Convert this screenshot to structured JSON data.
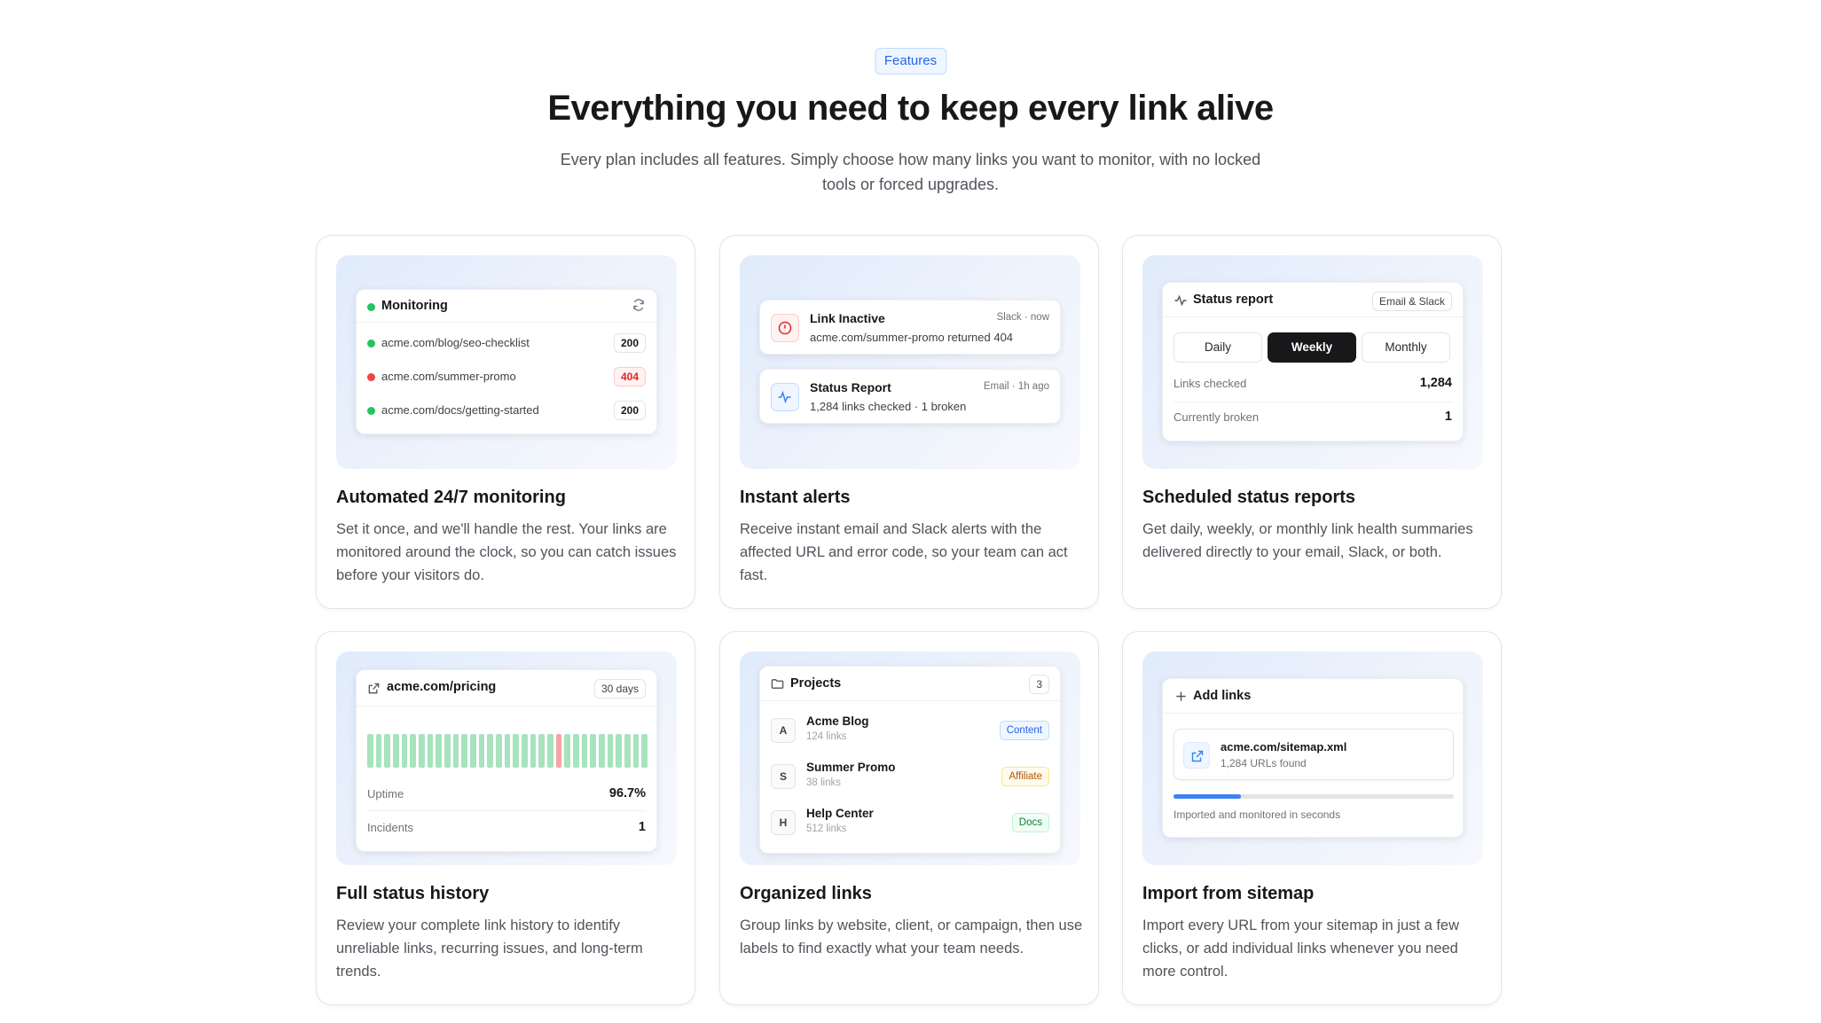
{
  "header": {
    "badge": "Features",
    "title": "Everything you need to keep every link alive",
    "subtitle": "Every plan includes all features. Simply choose how many links you want to monitor, with no locked tools or forced upgrades."
  },
  "colors": {
    "accent": "#2563eb",
    "ok": "#22c55e",
    "error": "#ef4444",
    "uptime_bar": "#a7e3bd",
    "incident_bar": "#f3a6a6"
  },
  "cards": {
    "monitoring": {
      "title": "Automated 24/7 monitoring",
      "desc": "Set it once, and we'll handle the rest. Your links are monitored around the clock, so you can catch issues before your visitors do.",
      "panel_title": "Monitoring",
      "refresh_icon": "refresh-icon",
      "rows": [
        {
          "url": "acme.com/blog/seo-checklist",
          "code": "200",
          "status": "ok"
        },
        {
          "url": "acme.com/summer-promo",
          "code": "404",
          "status": "error"
        },
        {
          "url": "acme.com/docs/getting-started",
          "code": "200",
          "status": "ok"
        }
      ]
    },
    "alerts": {
      "title": "Instant alerts",
      "desc": "Receive instant email and Slack alerts with the affected URL and error code, so your team can act fast.",
      "items": [
        {
          "icon": "alert-circle-icon",
          "title": "Link Inactive",
          "meta": "Slack · now",
          "body": "acme.com/summer-promo returned 404"
        },
        {
          "icon": "activity-icon",
          "title": "Status Report",
          "meta": "Email · 1h ago",
          "body": "1,284 links checked · 1 broken"
        }
      ]
    },
    "reports": {
      "title": "Scheduled status reports",
      "desc": "Get daily, weekly, or monthly link health summaries delivered directly to your email, Slack, or both.",
      "panel_title": "Status report",
      "channel": "Email & Slack",
      "tabs": [
        "Daily",
        "Weekly",
        "Monthly"
      ],
      "selected_tab": "Weekly",
      "stats": [
        {
          "label": "Links checked",
          "value": "1,284"
        },
        {
          "label": "Currently broken",
          "value": "1"
        }
      ]
    },
    "history": {
      "title": "Full status history",
      "desc": "Review your complete link history to identify unreliable links, recurring issues, and long-term trends.",
      "url": "acme.com/pricing",
      "range": "30 days",
      "bars": [
        "up",
        "up",
        "up",
        "up",
        "up",
        "up",
        "up",
        "up",
        "up",
        "up",
        "up",
        "up",
        "up",
        "up",
        "up",
        "up",
        "up",
        "up",
        "up",
        "up",
        "up",
        "up",
        "down",
        "up",
        "up",
        "up",
        "up",
        "up",
        "up",
        "up",
        "up",
        "up",
        "up"
      ],
      "stats": [
        {
          "label": "Uptime",
          "value": "96.7%"
        },
        {
          "label": "Incidents",
          "value": "1"
        }
      ]
    },
    "organized": {
      "title": "Organized links",
      "desc": "Group links by website, client, or campaign, then use labels to find exactly what your team needs.",
      "panel_title": "Projects",
      "count": "3",
      "projects": [
        {
          "initial": "A",
          "name": "Acme Blog",
          "links": "124 links",
          "label": "Content",
          "label_color": "#2563eb",
          "label_bg": "#eff6ff",
          "label_border": "#bfdbfe"
        },
        {
          "initial": "S",
          "name": "Summer Promo",
          "links": "38 links",
          "label": "Affiliate",
          "label_color": "#b45309",
          "label_bg": "#fffbeb",
          "label_border": "#fde68a"
        },
        {
          "initial": "H",
          "name": "Help Center",
          "links": "512 links",
          "label": "Docs",
          "label_color": "#15803d",
          "label_bg": "#f0fdf4",
          "label_border": "#bbf7d0"
        }
      ]
    },
    "sitemap": {
      "title": "Import from sitemap",
      "desc": "Import every URL from your sitemap in just a few clicks, or add individual links whenever you need more control.",
      "panel_title": "Add links",
      "file": "acme.com/sitemap.xml",
      "found": "1,284 URLs found",
      "progress": 0.24,
      "caption": "Imported and monitored in seconds"
    }
  }
}
